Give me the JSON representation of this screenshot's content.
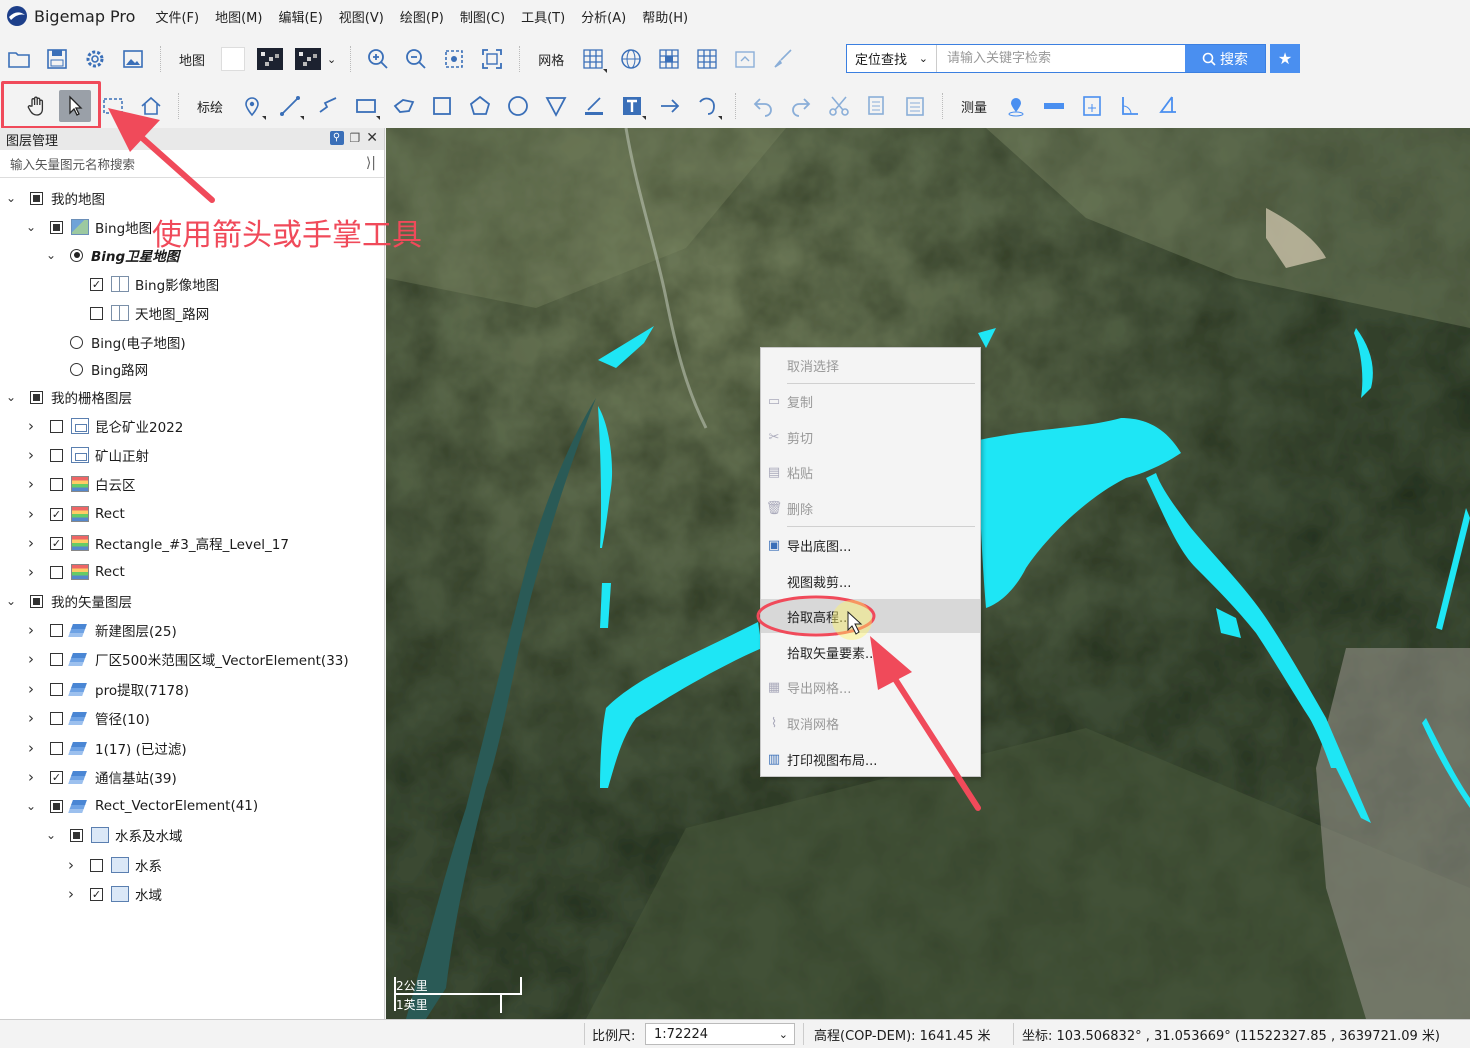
{
  "app": {
    "title": "Bigemap Pro"
  },
  "menu": [
    "文件(F)",
    "地图(M)",
    "编辑(E)",
    "视图(V)",
    "绘图(P)",
    "制图(C)",
    "工具(T)",
    "分析(A)",
    "帮助(H)"
  ],
  "toolbar1": {
    "map_label": "地图",
    "grid_label": "网格",
    "search": {
      "mode": "定位查找",
      "placeholder": "请输入关键字检索",
      "button": "搜索"
    }
  },
  "toolbar2": {
    "annotate_label": "标绘",
    "measure_label": "测量"
  },
  "layer_panel": {
    "title": "图层管理",
    "search_placeholder": "输入矢量图元名称搜索",
    "rows": [
      {
        "label": "我的地图",
        "level": 0,
        "expander": "open",
        "control": "filled",
        "icon": ""
      },
      {
        "label": "Bing地图",
        "level": 1,
        "expander": "open",
        "control": "filled",
        "icon": "map"
      },
      {
        "label": "Bing卫星地图",
        "level": 2,
        "expander": "open",
        "control": "radio-on",
        "icon": "",
        "style": "bold-italic"
      },
      {
        "label": "Bing影像地图",
        "level": 3,
        "expander": "",
        "control": "checked",
        "icon": "book"
      },
      {
        "label": "天地图_路网",
        "level": 3,
        "expander": "",
        "control": "empty",
        "icon": "book"
      },
      {
        "label": "Bing(电子地图)",
        "level": 2,
        "expander": "",
        "control": "radio-off",
        "icon": ""
      },
      {
        "label": "Bing路网",
        "level": 2,
        "expander": "",
        "control": "radio-off",
        "icon": ""
      },
      {
        "label": "我的栅格图层",
        "level": 0,
        "expander": "open",
        "control": "filled",
        "icon": ""
      },
      {
        "label": "昆仑矿业2022",
        "level": 1,
        "expander": "closed",
        "control": "empty",
        "icon": "img"
      },
      {
        "label": "矿山正射",
        "level": 1,
        "expander": "closed",
        "control": "empty",
        "icon": "img"
      },
      {
        "label": "白云区",
        "level": 1,
        "expander": "closed",
        "control": "empty",
        "icon": "raster"
      },
      {
        "label": "Rect",
        "level": 1,
        "expander": "closed",
        "control": "checked",
        "icon": "raster"
      },
      {
        "label": "Rectangle_#3_高程_Level_17",
        "level": 1,
        "expander": "closed",
        "control": "checked",
        "icon": "raster"
      },
      {
        "label": "Rect",
        "level": 1,
        "expander": "closed",
        "control": "empty",
        "icon": "raster"
      },
      {
        "label": "我的矢量图层",
        "level": 0,
        "expander": "open",
        "control": "filled",
        "icon": ""
      },
      {
        "label": "新建图层(25)",
        "level": 1,
        "expander": "closed",
        "control": "empty",
        "icon": "vector"
      },
      {
        "label": "厂区500米范围区域_VectorElement(33)",
        "level": 1,
        "expander": "closed",
        "control": "empty",
        "icon": "vector"
      },
      {
        "label": "pro提取(7178)",
        "level": 1,
        "expander": "closed",
        "control": "empty",
        "icon": "vector"
      },
      {
        "label": "管径(10)",
        "level": 1,
        "expander": "closed",
        "control": "empty",
        "icon": "vector"
      },
      {
        "label": "1(17) (已过滤)",
        "level": 1,
        "expander": "closed",
        "control": "empty",
        "icon": "vector"
      },
      {
        "label": "通信基站(39)",
        "level": 1,
        "expander": "closed",
        "control": "checked",
        "icon": "vector"
      },
      {
        "label": "Rect_VectorElement(41)",
        "level": 1,
        "expander": "open",
        "control": "filled",
        "icon": "vector"
      },
      {
        "label": "水系及水域",
        "level": 2,
        "expander": "open",
        "control": "filled",
        "icon": "folder"
      },
      {
        "label": "水系",
        "level": 3,
        "expander": "closed",
        "control": "empty",
        "icon": "folder"
      },
      {
        "label": "水域",
        "level": 3,
        "expander": "closed",
        "control": "checked",
        "icon": "folder"
      }
    ]
  },
  "annotation": {
    "text": "使用箭头或手掌工具",
    "color": "#f04a5a"
  },
  "context_menu": {
    "items": [
      {
        "label": "取消选择",
        "disabled": true,
        "icon": ""
      },
      {
        "label": "复制",
        "disabled": true,
        "icon": "copy-icon"
      },
      {
        "label": "剪切",
        "disabled": true,
        "icon": "scissors-icon"
      },
      {
        "label": "粘贴",
        "disabled": true,
        "icon": "paste-icon"
      },
      {
        "label": "删除",
        "disabled": true,
        "icon": "trash-icon"
      },
      {
        "label": "导出底图...",
        "disabled": false,
        "icon": "export-map-icon"
      },
      {
        "label": "视图裁剪...",
        "disabled": false,
        "icon": ""
      },
      {
        "label": "拾取高程...",
        "disabled": false,
        "icon": "",
        "hover": true
      },
      {
        "label": "拾取矢量要素...",
        "disabled": false,
        "icon": ""
      },
      {
        "label": "导出网格...",
        "disabled": true,
        "icon": "grid-icon"
      },
      {
        "label": "取消网格",
        "disabled": true,
        "icon": "brush-icon"
      },
      {
        "label": "打印视图布局...",
        "disabled": false,
        "icon": "print-icon"
      }
    ]
  },
  "map": {
    "scale_top": "2公里",
    "scale_bottom": "1英里",
    "water_color": "#1ee6f5"
  },
  "statusbar": {
    "scale_label": "比例尺:",
    "scale_value": "1:72224",
    "elevation": "高程(COP-DEM): 1641.45 米",
    "coords": "坐标: 103.506832° , 31.053669°  (11522327.85 , 3639721.09 米)"
  }
}
